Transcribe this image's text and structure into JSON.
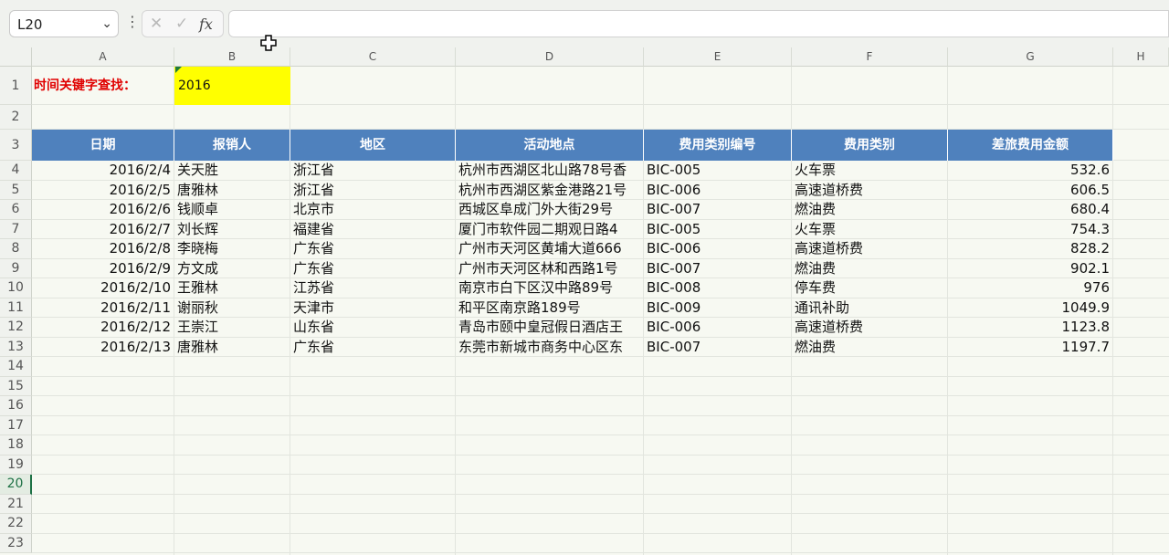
{
  "name_box": "L20",
  "formula_bar": {
    "value": ""
  },
  "columns": [
    "A",
    "B",
    "C",
    "D",
    "E",
    "F",
    "G",
    "H"
  ],
  "rows": [
    "1",
    "2",
    "3",
    "4",
    "5",
    "6",
    "7",
    "8",
    "9",
    "10",
    "11",
    "12",
    "13",
    "14",
    "15",
    "16",
    "17",
    "18",
    "19",
    "20",
    "21",
    "22",
    "23"
  ],
  "selected_row": "20",
  "search": {
    "label": "时间关键字查找：",
    "value": "2016"
  },
  "table": {
    "headers": [
      "日期",
      "报销人",
      "地区",
      "活动地点",
      "费用类别编号",
      "费用类别",
      "差旅费用金额"
    ],
    "rows": [
      [
        "2016/2/4",
        "关天胜",
        "浙江省",
        "杭州市西湖区北山路78号香",
        "BIC-005",
        "火车票",
        "532.6"
      ],
      [
        "2016/2/5",
        "唐雅林",
        "浙江省",
        "杭州市西湖区紫金港路21号",
        "BIC-006",
        "高速道桥费",
        "606.5"
      ],
      [
        "2016/2/6",
        "钱顺卓",
        "北京市",
        "西城区阜成门外大街29号",
        "BIC-007",
        "燃油费",
        "680.4"
      ],
      [
        "2016/2/7",
        "刘长辉",
        "福建省",
        "厦门市软件园二期观日路4",
        "BIC-005",
        "火车票",
        "754.3"
      ],
      [
        "2016/2/8",
        "李晓梅",
        "广东省",
        "广州市天河区黄埔大道666",
        "BIC-006",
        "高速道桥费",
        "828.2"
      ],
      [
        "2016/2/9",
        "方文成",
        "广东省",
        "广州市天河区林和西路1号",
        "BIC-007",
        "燃油费",
        "902.1"
      ],
      [
        "2016/2/10",
        "王雅林",
        "江苏省",
        "南京市白下区汉中路89号",
        "BIC-008",
        "停车费",
        "976"
      ],
      [
        "2016/2/11",
        "谢丽秋",
        "天津市",
        "和平区南京路189号",
        "BIC-009",
        "通讯补助",
        "1049.9"
      ],
      [
        "2016/2/12",
        "王崇江",
        "山东省",
        "青岛市颐中皇冠假日酒店王",
        "BIC-006",
        "高速道桥费",
        "1123.8"
      ],
      [
        "2016/2/13",
        "唐雅林",
        "广东省",
        "东莞市新城市商务中心区东",
        "BIC-007",
        "燃油费",
        "1197.7"
      ]
    ]
  },
  "colors": {
    "header_fill": "#4f81bd",
    "search_fill": "#ffff00",
    "label_red": "#e00000",
    "select_green": "#1e7145"
  },
  "icons": [
    "chevron-down-icon",
    "more-vertical-icon",
    "cancel-x-icon",
    "check-icon",
    "function-fx-icon",
    "move-cursor-icon"
  ]
}
